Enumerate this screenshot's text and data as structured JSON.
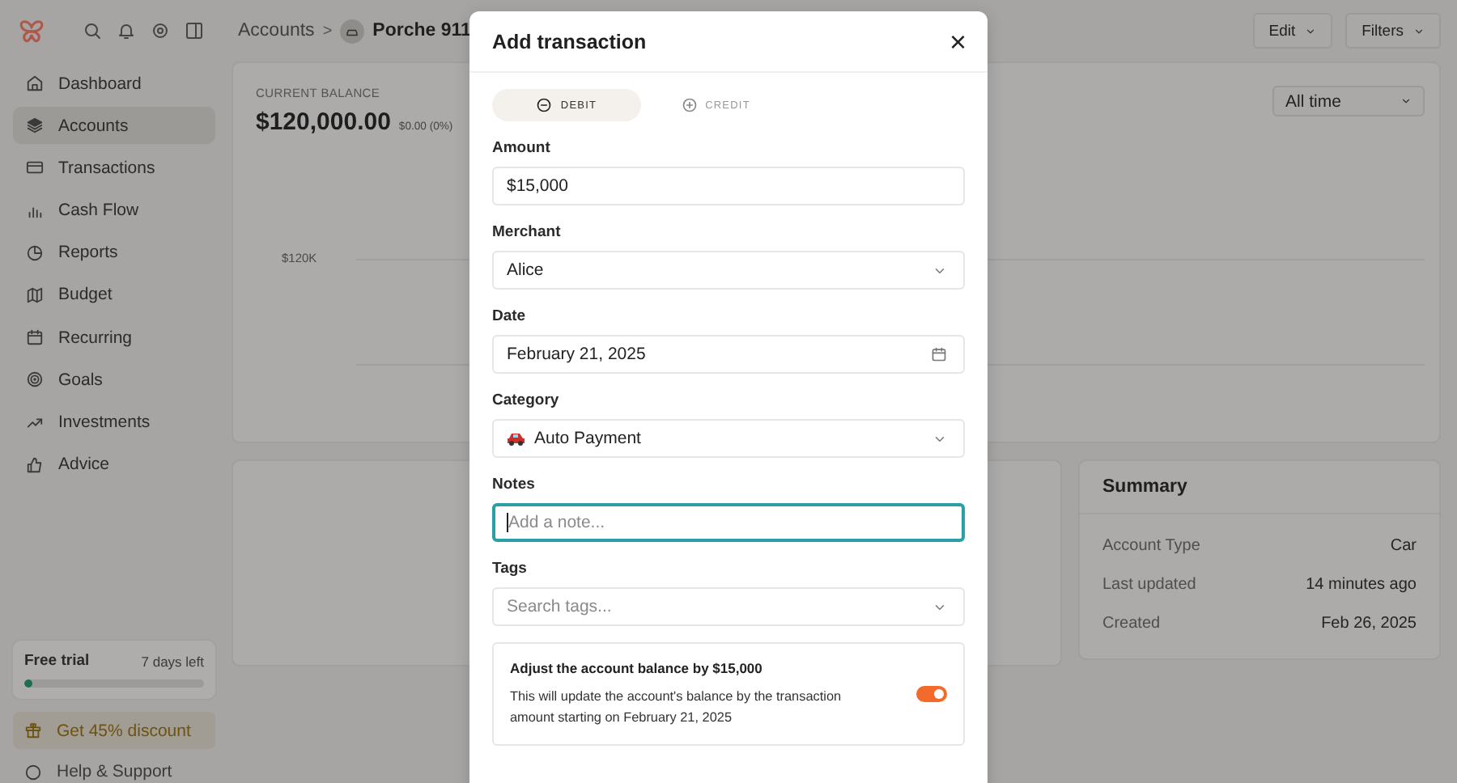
{
  "sidebar": {
    "nav": [
      {
        "label": "Dashboard",
        "selected": false
      },
      {
        "label": "Accounts",
        "selected": true
      },
      {
        "label": "Transactions",
        "selected": false
      },
      {
        "label": "Cash Flow",
        "selected": false
      },
      {
        "label": "Reports",
        "selected": false
      },
      {
        "label": "Budget",
        "selected": false
      },
      {
        "label": "Recurring",
        "selected": false
      },
      {
        "label": "Goals",
        "selected": false
      },
      {
        "label": "Investments",
        "selected": false
      },
      {
        "label": "Advice",
        "selected": false
      }
    ],
    "trial": {
      "title": "Free trial",
      "remaining": "7 days left",
      "level": 0.04
    },
    "discount": "Get 45% discount",
    "help": "Help & Support"
  },
  "header": {
    "breadcrumb": "Accounts",
    "separator": ">",
    "account": "Porche 911",
    "buttons": [
      "Edit",
      "Filters"
    ]
  },
  "balance_card": {
    "label": "CURRENT BALANCE",
    "amount": "$120,000.00",
    "change": "$0.00 (0%)",
    "range": "All time",
    "y_axis_label": "$120K"
  },
  "summary": {
    "title": "Summary",
    "rows": [
      {
        "label": "Account Type",
        "value": "Car"
      },
      {
        "label": "Last updated",
        "value": "14 minutes ago"
      },
      {
        "label": "Created",
        "value": "Feb 26, 2025"
      }
    ]
  },
  "modal": {
    "title": "Add transaction",
    "close": "×",
    "types": [
      {
        "label": "DEBIT",
        "kind": "minus",
        "selected": true
      },
      {
        "label": "CREDIT",
        "kind": "plus",
        "selected": false
      }
    ],
    "fields": [
      {
        "label": "Amount",
        "kind": "text",
        "value": "$15,000",
        "focused": false
      },
      {
        "label": "Merchant",
        "kind": "select",
        "value": "Alice",
        "focused": false
      },
      {
        "label": "Date",
        "kind": "date",
        "value": "February 21, 2025",
        "focused": false
      },
      {
        "label": "Category",
        "kind": "iconselect",
        "value": "Auto Payment",
        "focused": false
      },
      {
        "label": "Notes",
        "kind": "text",
        "placeholder": "Add a note...",
        "focused": true
      },
      {
        "label": "Tags",
        "kind": "select",
        "placeholder": "Search tags...",
        "focused": false
      }
    ],
    "adjust": {
      "title": "Adjust the account balance by $15,000",
      "description": "This will update the account's balance by the transaction amount starting on February 21, 2025",
      "on": true
    }
  }
}
